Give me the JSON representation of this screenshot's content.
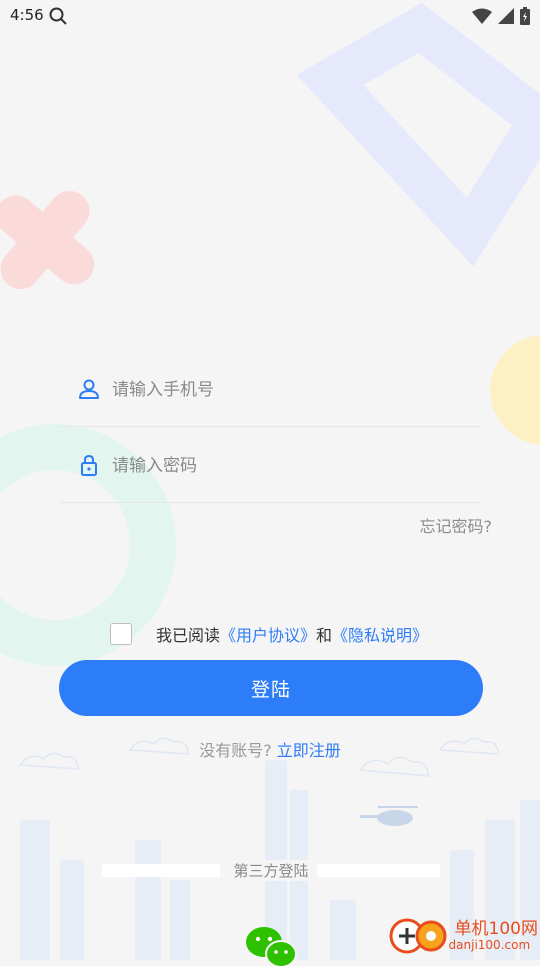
{
  "status_bar": {
    "time": "4:56"
  },
  "form": {
    "phone_placeholder": "请输入手机号",
    "password_placeholder": "请输入密码",
    "forgot_password": "忘记密码?"
  },
  "agreement": {
    "prefix": "我已阅读",
    "user_agreement": "《用户协议》",
    "and": "和",
    "privacy_policy": "《隐私说明》"
  },
  "login_button": "登陆",
  "register": {
    "prompt": "没有账号?",
    "link": "立即注册"
  },
  "third_party": {
    "label": "第三方登陆"
  },
  "watermark": {
    "title": "单机100网",
    "url": "danji100.com"
  },
  "colors": {
    "accent": "#2c7df7",
    "link": "#2f7df6",
    "background": "#f5f5f6"
  }
}
